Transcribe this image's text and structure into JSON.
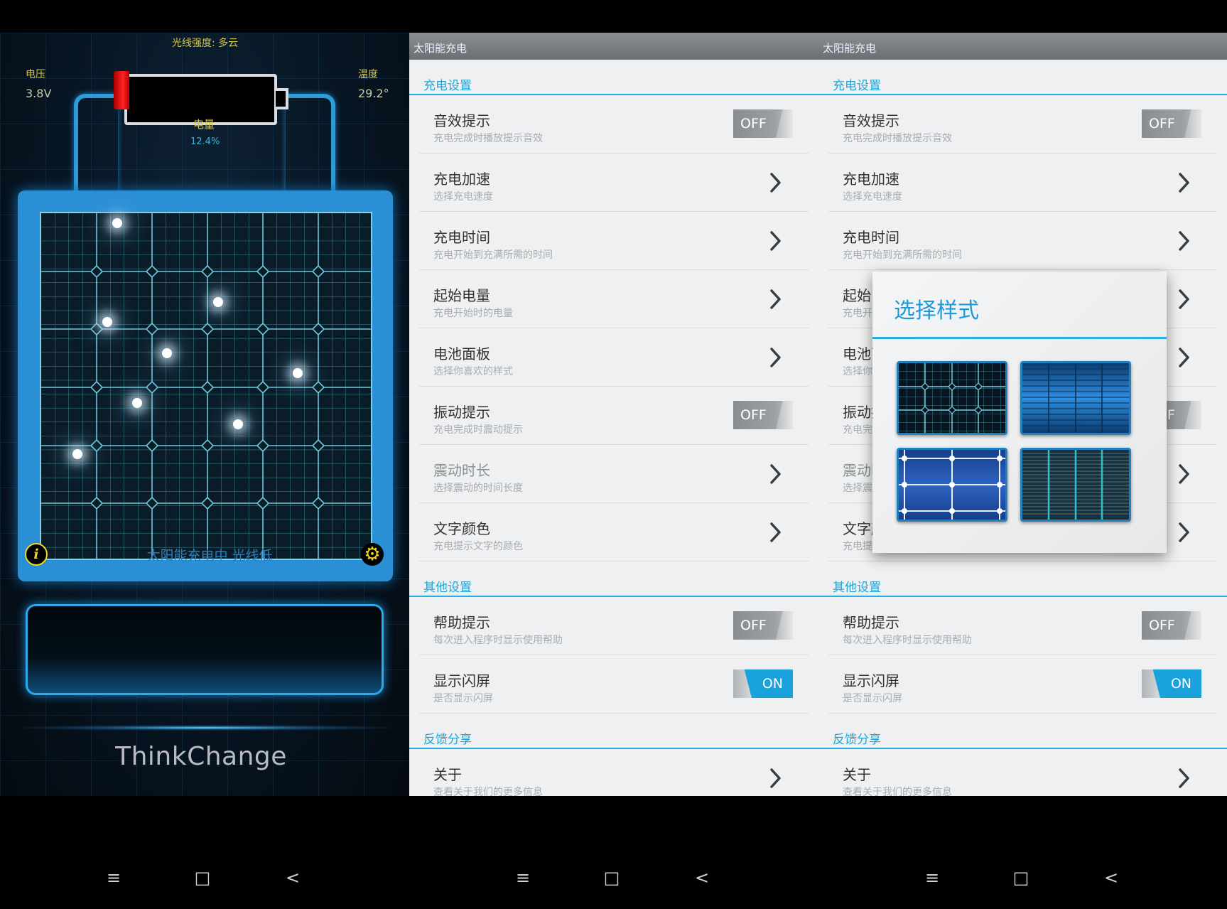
{
  "screen1": {
    "light_label": "光线强度: 多云",
    "voltage_label": "电压",
    "voltage_value": "3.8V",
    "temperature_label": "温度",
    "temperature_value": "29.2°",
    "charge_label": "电量",
    "charge_value": "12.4%",
    "panel_caption": "太阳能充电中 光线低",
    "brand": "ThinkChange"
  },
  "settings": {
    "app_title": "太阳能充电",
    "sections": {
      "charge": "充电设置",
      "other": "其他设置",
      "feedback": "反馈分享"
    },
    "rows": [
      {
        "title": "音效提示",
        "subtitle": "充电完成时播放提示音效",
        "control": "toggle",
        "state": "OFF"
      },
      {
        "title": "充电加速",
        "subtitle": "选择充电速度",
        "control": "chevron"
      },
      {
        "title": "充电时间",
        "subtitle": "充电开始到充满所需的时间",
        "control": "chevron"
      },
      {
        "title": "起始电量",
        "subtitle": "充电开始时的电量",
        "control": "chevron"
      },
      {
        "title": "电池面板",
        "subtitle": "选择你喜欢的样式",
        "control": "chevron"
      },
      {
        "title": "振动提示",
        "subtitle": "充电完成时震动提示",
        "control": "toggle",
        "state": "OFF"
      },
      {
        "title": "震动时长",
        "subtitle": "选择震动的时间长度",
        "control": "chevron",
        "disabled": true
      },
      {
        "title": "文字颜色",
        "subtitle": "充电提示文字的颜色",
        "control": "chevron"
      }
    ],
    "other_rows": [
      {
        "title": "帮助提示",
        "subtitle": "每次进入程序时显示使用帮助",
        "control": "toggle",
        "state": "OFF"
      },
      {
        "title": "显示闪屏",
        "subtitle": "是否显示闪屏",
        "control": "toggle",
        "state": "ON"
      }
    ],
    "feedback_rows": [
      {
        "title": "关于",
        "subtitle": "查看关于我们的更多信息",
        "control": "chevron"
      }
    ]
  },
  "dialog": {
    "title": "选择样式",
    "options": [
      "panel-style-1",
      "panel-style-2",
      "panel-style-3",
      "panel-style-4"
    ]
  },
  "nav": {
    "menu_icon": "≡",
    "home_icon": "□",
    "back_icon": "<"
  },
  "colors": {
    "accent": "#2aaee0",
    "toggle_on": "#1aa2dc",
    "panel_blue": "#2b8fd6",
    "status_yellow": "#d8c94a"
  }
}
